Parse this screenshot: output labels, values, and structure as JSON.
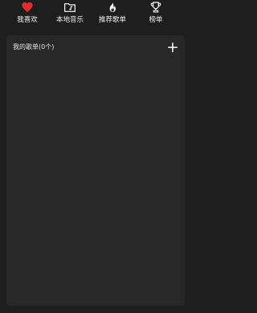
{
  "nav": {
    "items": [
      {
        "label": "我喜欢",
        "icon": "heart-icon",
        "icon_color": "#e02e2e"
      },
      {
        "label": "本地音乐",
        "icon": "music-folder-icon",
        "icon_color": "#ffffff"
      },
      {
        "label": "推荐歌单",
        "icon": "flame-icon",
        "icon_color": "#ffffff"
      },
      {
        "label": "榜单",
        "icon": "trophy-icon",
        "icon_color": "#ffffff"
      }
    ]
  },
  "playlist_panel": {
    "title": "我的歌单(0个)",
    "add_icon": "plus-icon"
  },
  "colors": {
    "background": "#1e1e1e",
    "panel": "#282828",
    "accent": "#e02e2e"
  }
}
